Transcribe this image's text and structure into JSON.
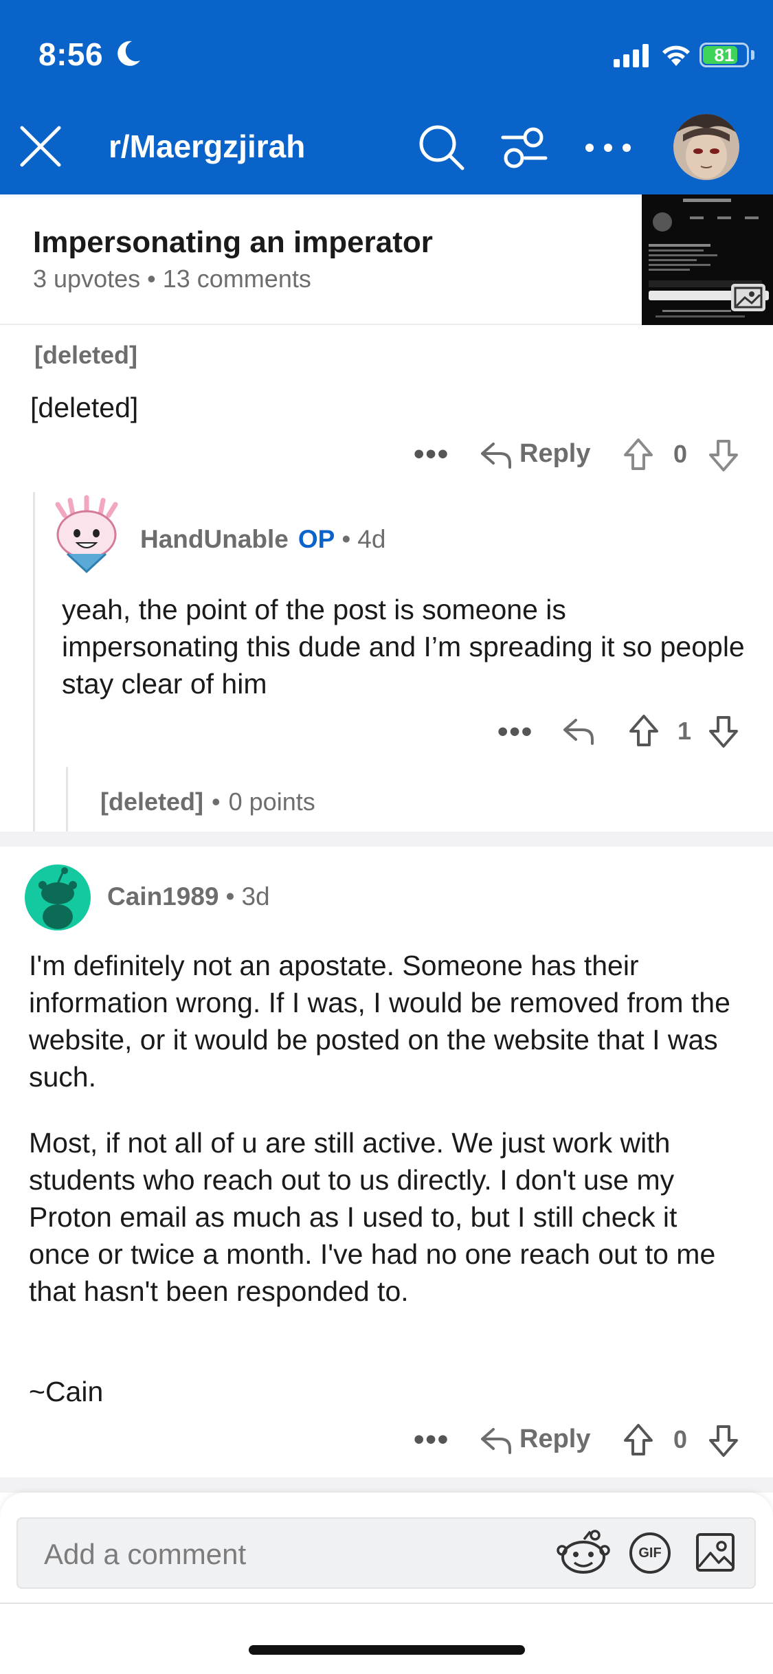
{
  "status": {
    "time": "8:56",
    "battery": "81",
    "battery_level": 0.81
  },
  "header": {
    "subreddit": "r/Maergzjirah"
  },
  "post": {
    "title": "Impersonating an imperator",
    "upvotes": "3 upvotes",
    "comments": "13 comments"
  },
  "comments": [
    {
      "author": "[deleted]",
      "body": "[deleted]",
      "reply_label": "Reply",
      "score": "0"
    },
    {
      "author": "HandUnable",
      "op_badge": "OP",
      "age": "4d",
      "body": "yeah, the point of the post is someone is impersonating this dude and I’m spreading it so people stay clear of him",
      "score": "1"
    },
    {
      "author": "[deleted]",
      "points": "0 points"
    },
    {
      "author": "Cain1989",
      "age": "3d",
      "para1": "I'm definitely not an apostate. Someone has their information wrong. If I was, I would be removed from the website, or it would be posted on the website that I was such.",
      "para2": "Most, if not all of u are still active. We just work with students who reach out to us directly. I don't use my Proton email as much as I used to, but I still check it once or twice a month. I've had no one reach out to me that hasn't been responded to.",
      "signoff": "~Cain",
      "reply_label": "Reply",
      "score": "0"
    }
  ],
  "composer": {
    "placeholder": "Add a comment",
    "gif_label": "GIF"
  },
  "colors": {
    "header_bg": "#0a63c9",
    "op_blue": "#0a63c9",
    "text": "#1a1a1b",
    "muted": "#6d6d6d",
    "battery_green": "#3fd35a"
  }
}
